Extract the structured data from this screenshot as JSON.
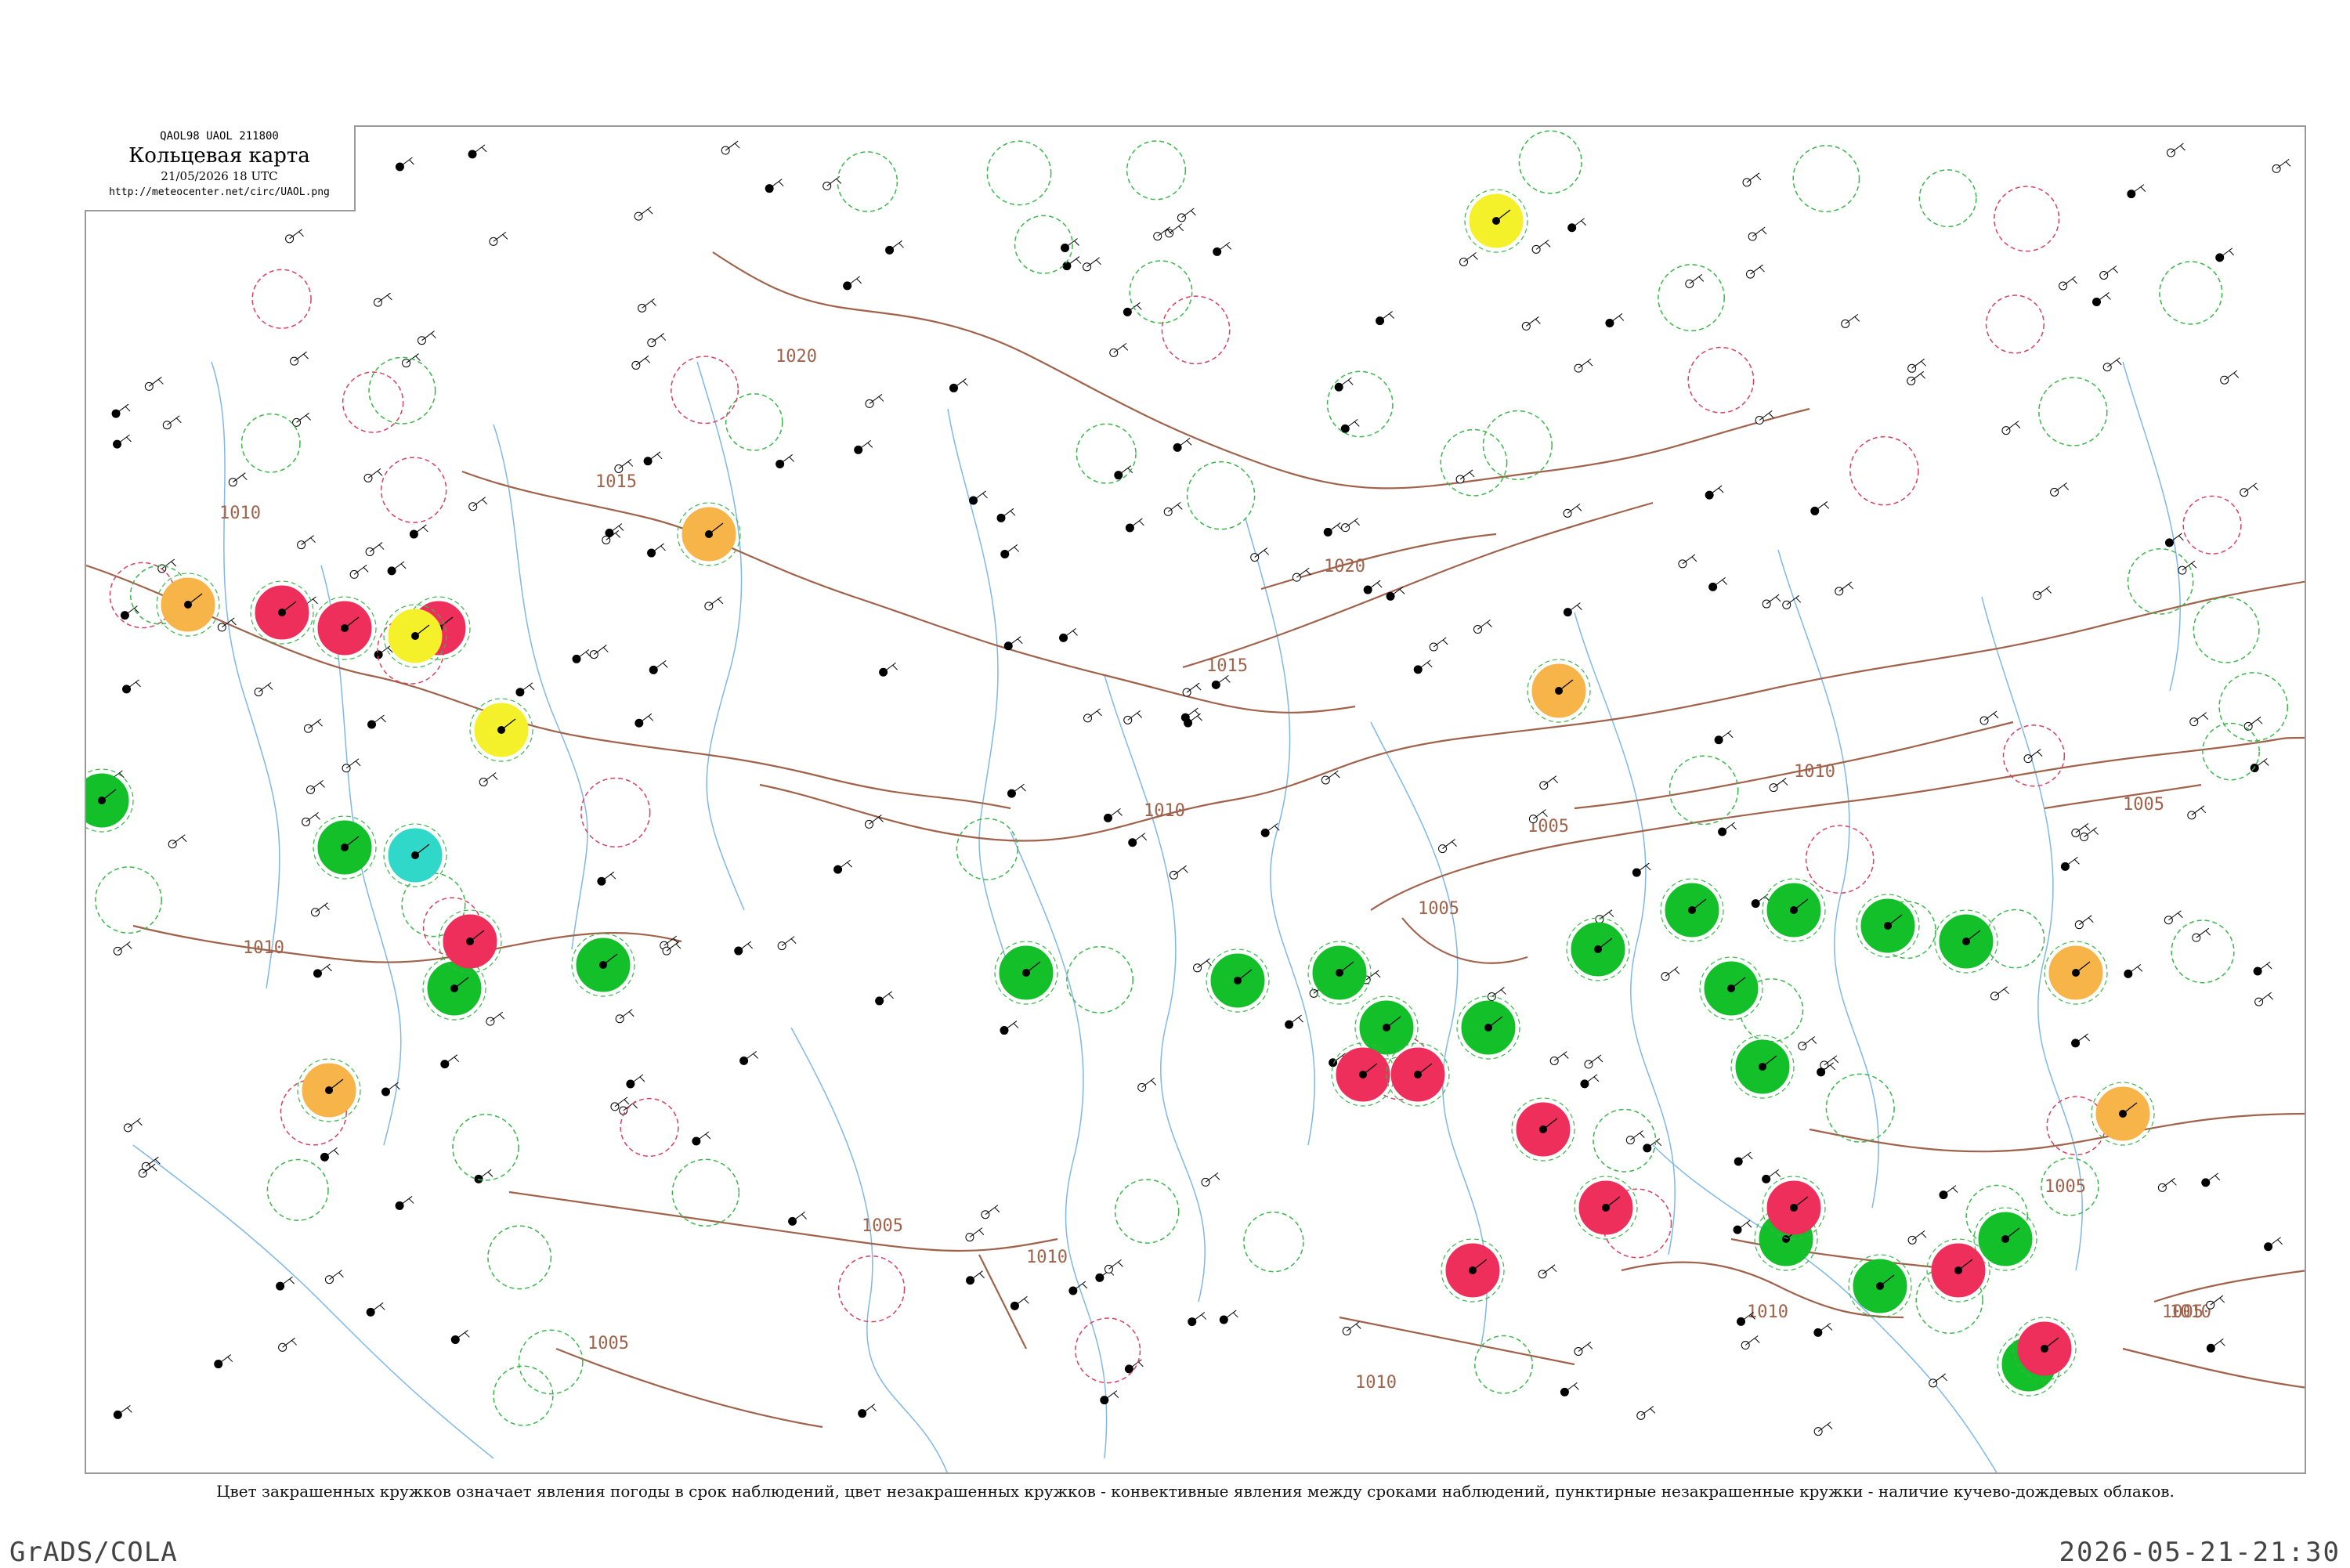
{
  "header": {
    "codes": "QAOL98  UAOL  211800",
    "title": "Кольцевая карта",
    "date": "21/05/2026 18 UTC",
    "url": "http://meteocenter.net/circ/UAOL.png"
  },
  "caption": "Цвет закрашенных кружков означает явления погоды в срок наблюдений, цвет незакрашенных кружков - конвективные явления между сроками наблюдений, пунктирные незакрашенные кружки - наличие кучево-дождевых облаков.",
  "footer": {
    "left": "GrADS/COLA",
    "right": "2026-05-21-21:30"
  },
  "colors": {
    "isobar": "#a0624a",
    "river": "#7fb8e8",
    "coast": "#7aa8d8",
    "green": "#13c02a",
    "red": "#ee2f5c",
    "orange": "#f7b449",
    "yellow": "#f4f02a",
    "cyan": "#2fd8c8",
    "dash_green": "#3ab74a",
    "dash_red": "#d84060"
  },
  "isobars": [
    {
      "label": "1010"
    },
    {
      "label": "1015"
    },
    {
      "label": "1020"
    },
    {
      "label": "1015"
    },
    {
      "label": "1010"
    },
    {
      "label": "1005"
    },
    {
      "label": "1005"
    },
    {
      "label": "1010"
    },
    {
      "label": "1005"
    },
    {
      "label": "1020"
    },
    {
      "label": "1010"
    },
    {
      "label": "1005"
    },
    {
      "label": "1010"
    },
    {
      "label": "1005"
    },
    {
      "label": "1010"
    },
    {
      "label": "1005"
    },
    {
      "label": "1010"
    },
    {
      "label": "1010"
    },
    {
      "label": "1005"
    },
    {
      "label": "1010"
    }
  ],
  "stations": {
    "filled": [
      {
        "color": "green",
        "t": "",
        "td": ""
      },
      {
        "color": "green",
        "t": "",
        "td": ""
      },
      {
        "color": "green",
        "t": "",
        "td": ""
      },
      {
        "color": "green",
        "t": "",
        "td": ""
      },
      {
        "color": "green",
        "t": "",
        "td": ""
      },
      {
        "color": "green",
        "t": "",
        "td": ""
      },
      {
        "color": "green",
        "t": "",
        "td": ""
      },
      {
        "color": "green",
        "t": "",
        "td": ""
      },
      {
        "color": "green",
        "t": "",
        "td": ""
      },
      {
        "color": "green",
        "t": "",
        "td": ""
      },
      {
        "color": "green",
        "t": "",
        "td": ""
      },
      {
        "color": "green",
        "t": "",
        "td": ""
      },
      {
        "color": "green",
        "t": "",
        "td": ""
      },
      {
        "color": "green",
        "t": "",
        "td": ""
      },
      {
        "color": "green",
        "t": "",
        "td": ""
      },
      {
        "color": "green",
        "t": "",
        "td": ""
      },
      {
        "color": "green",
        "t": "",
        "td": ""
      },
      {
        "color": "green",
        "t": "",
        "td": ""
      },
      {
        "color": "green",
        "t": "",
        "td": ""
      },
      {
        "color": "green",
        "t": "",
        "td": ""
      },
      {
        "color": "red",
        "t": "",
        "td": ""
      },
      {
        "color": "red",
        "t": "",
        "td": ""
      },
      {
        "color": "red",
        "t": "",
        "td": ""
      },
      {
        "color": "red",
        "t": "",
        "td": ""
      },
      {
        "color": "red",
        "t": "",
        "td": ""
      },
      {
        "color": "red",
        "t": "",
        "td": ""
      },
      {
        "color": "red",
        "t": "",
        "td": ""
      },
      {
        "color": "red",
        "t": "",
        "td": ""
      },
      {
        "color": "red",
        "t": "",
        "td": ""
      },
      {
        "color": "red",
        "t": "",
        "td": ""
      },
      {
        "color": "red",
        "t": "",
        "td": ""
      },
      {
        "color": "red",
        "t": "",
        "td": ""
      },
      {
        "color": "orange",
        "t": "",
        "td": ""
      },
      {
        "color": "orange",
        "t": "",
        "td": ""
      },
      {
        "color": "orange",
        "t": "",
        "td": ""
      },
      {
        "color": "orange",
        "t": "",
        "td": ""
      },
      {
        "color": "orange",
        "t": "",
        "td": ""
      },
      {
        "color": "orange",
        "t": "",
        "td": ""
      },
      {
        "color": "yellow",
        "t": "",
        "td": ""
      },
      {
        "color": "yellow",
        "t": "",
        "td": ""
      },
      {
        "color": "yellow",
        "t": "",
        "td": ""
      },
      {
        "color": "cyan",
        "t": "",
        "td": ""
      }
    ]
  }
}
